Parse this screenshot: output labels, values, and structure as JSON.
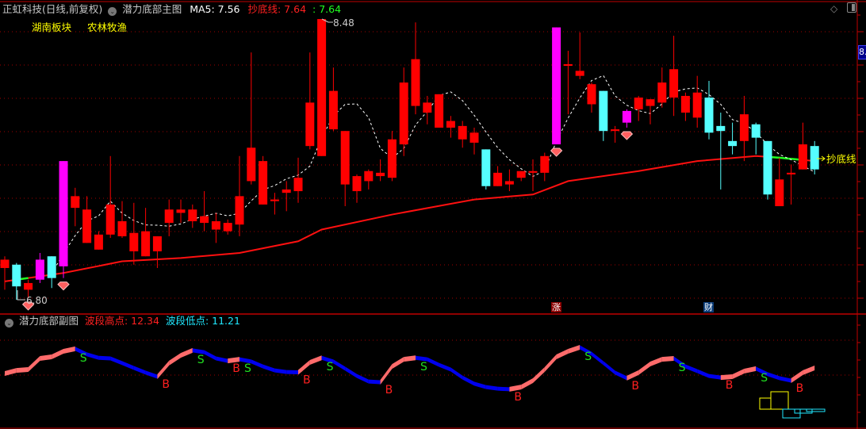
{
  "header": {
    "stock_title": "正虹科技(日线,前复权)",
    "main_indicator": "潜力底部主图",
    "ma5_label": "MA5: 7.56",
    "chaodi_label": "抄底线: 7.64",
    "chaodi_value2": ": 7.64",
    "sectors": [
      "湖南板块",
      "农林牧渔"
    ]
  },
  "sub_header": {
    "indicator": "潜力底部副图",
    "high_label": "波段高点: 12.34",
    "low_label": "波段低点: 11.21"
  },
  "annotations": {
    "high_marker": "8.48",
    "low_marker": "6.80",
    "chaodi_line_label": "抄底线",
    "badge_zhang": "涨",
    "badge_cai": "财",
    "axis_value": "8."
  },
  "colors": {
    "up": "#ff0000",
    "down": "#55ffff",
    "limit": "#ff00ff",
    "ma_long": "#ff1010",
    "rise": "#ff6b6b",
    "fall": "#0000ee"
  },
  "chart_data": {
    "type": "candlestick",
    "candles": [
      [
        6.99,
        7.06,
        6.86,
        7.04
      ],
      [
        7.01,
        7.02,
        6.8,
        6.88
      ],
      [
        6.86,
        6.92,
        6.81,
        6.9
      ],
      [
        6.92,
        7.08,
        6.9,
        7.04,
        "limit"
      ],
      [
        7.06,
        7.06,
        6.87,
        6.93
      ],
      [
        7.0,
        7.63,
        6.93,
        7.63,
        "limit"
      ],
      [
        7.35,
        7.47,
        7.24,
        7.42
      ],
      [
        7.14,
        7.42,
        7.14,
        7.34
      ],
      [
        7.1,
        7.21,
        7.1,
        7.19
      ],
      [
        7.19,
        7.66,
        7.17,
        7.37
      ],
      [
        7.18,
        7.39,
        7.17,
        7.27
      ],
      [
        7.09,
        7.38,
        7.01,
        7.2
      ],
      [
        7.06,
        7.35,
        7.06,
        7.21
      ],
      [
        7.09,
        7.18,
        6.99,
        7.18
      ],
      [
        7.26,
        7.4,
        7.18,
        7.34
      ],
      [
        7.32,
        7.4,
        7.26,
        7.34
      ],
      [
        7.27,
        7.37,
        7.23,
        7.34
      ],
      [
        7.26,
        7.45,
        7.21,
        7.3
      ],
      [
        7.22,
        7.32,
        7.14,
        7.27
      ],
      [
        7.21,
        7.28,
        7.19,
        7.26
      ],
      [
        7.25,
        7.66,
        7.18,
        7.42
      ],
      [
        7.51,
        8.28,
        7.49,
        7.71
      ],
      [
        7.37,
        7.66,
        7.37,
        7.63
      ],
      [
        7.39,
        7.44,
        7.31,
        7.4
      ],
      [
        7.44,
        7.51,
        7.33,
        7.46
      ],
      [
        7.45,
        7.65,
        7.38,
        7.53
      ],
      [
        7.72,
        8.28,
        7.7,
        7.98
      ],
      [
        7.66,
        8.48,
        7.66,
        8.48
      ],
      [
        7.82,
        8.19,
        7.81,
        8.05
      ],
      [
        7.49,
        7.81,
        7.36,
        7.81
      ],
      [
        7.45,
        7.55,
        7.38,
        7.54
      ],
      [
        7.51,
        7.58,
        7.46,
        7.57
      ],
      [
        7.54,
        7.64,
        7.51,
        7.56
      ],
      [
        7.53,
        7.81,
        7.51,
        7.76
      ],
      [
        7.73,
        8.19,
        7.66,
        8.1
      ],
      [
        7.96,
        8.46,
        7.91,
        8.24
      ],
      [
        7.92,
        8.02,
        7.85,
        7.98
      ],
      [
        7.83,
        8.03,
        7.83,
        8.03
      ],
      [
        7.83,
        7.9,
        7.77,
        7.87
      ],
      [
        7.76,
        7.87,
        7.71,
        7.84
      ],
      [
        7.74,
        7.83,
        7.67,
        7.8
      ],
      [
        7.7,
        7.7,
        7.46,
        7.48
      ],
      [
        7.48,
        7.6,
        7.48,
        7.56
      ],
      [
        7.49,
        7.58,
        7.45,
        7.51
      ],
      [
        7.53,
        7.57,
        7.51,
        7.57
      ],
      [
        7.56,
        7.64,
        7.45,
        7.57
      ],
      [
        7.56,
        7.68,
        7.51,
        7.66
      ],
      [
        7.73,
        8.43,
        7.73,
        8.43,
        "limit"
      ],
      [
        8.2,
        8.29,
        7.91,
        8.21
      ],
      [
        8.14,
        8.4,
        8.12,
        8.17
      ],
      [
        7.97,
        8.1,
        7.92,
        8.09
      ],
      [
        8.05,
        8.05,
        7.75,
        7.81
      ],
      [
        7.81,
        7.84,
        7.74,
        7.82
      ],
      [
        7.86,
        7.94,
        7.83,
        7.93,
        "limit"
      ],
      [
        7.94,
        8.02,
        7.87,
        8.01
      ],
      [
        7.96,
        8.0,
        7.85,
        8.0
      ],
      [
        7.98,
        8.19,
        7.95,
        8.1
      ],
      [
        8.01,
        8.38,
        7.9,
        8.18
      ],
      [
        7.92,
        8.04,
        7.87,
        8.02
      ],
      [
        7.89,
        8.14,
        7.83,
        8.04
      ],
      [
        8.01,
        8.11,
        7.76,
        7.8
      ],
      [
        7.84,
        7.92,
        7.46,
        7.81
      ],
      [
        7.75,
        7.86,
        7.67,
        7.72
      ],
      [
        7.75,
        8.02,
        7.63,
        7.91
      ],
      [
        7.85,
        7.86,
        7.67,
        7.77
      ],
      [
        7.75,
        7.75,
        7.4,
        7.43
      ],
      [
        7.36,
        7.65,
        7.36,
        7.52
      ],
      [
        7.55,
        7.61,
        7.37,
        7.56
      ],
      [
        7.58,
        7.86,
        7.58,
        7.73
      ],
      [
        7.72,
        7.75,
        7.55,
        7.58
      ]
    ],
    "price_range": [
      6.8,
      8.48
    ],
    "ma_long": [
      [
        0,
        6.91
      ],
      [
        5,
        6.96
      ],
      [
        10,
        7.03
      ],
      [
        15,
        7.05
      ],
      [
        20,
        7.08
      ],
      [
        25,
        7.15
      ],
      [
        27,
        7.22
      ],
      [
        33,
        7.31
      ],
      [
        40,
        7.4
      ],
      [
        45,
        7.43
      ],
      [
        48,
        7.51
      ],
      [
        54,
        7.57
      ],
      [
        59,
        7.63
      ],
      [
        64,
        7.66
      ],
      [
        66,
        7.65
      ],
      [
        69,
        7.63
      ]
    ],
    "ma_long_green_ranges": [
      [
        1,
        2
      ],
      [
        65,
        68
      ]
    ],
    "signal_diamonds": [
      2,
      5,
      47,
      53
    ],
    "wave": [
      11.26,
      11.36,
      11.39,
      11.75,
      11.8,
      11.98,
      12.06,
      11.88,
      11.77,
      11.75,
      11.6,
      11.44,
      11.29,
      11.16,
      11.6,
      11.85,
      12.01,
      11.95,
      11.75,
      11.67,
      11.72,
      11.65,
      11.49,
      11.36,
      11.31,
      11.3,
      11.62,
      11.77,
      11.65,
      11.42,
      11.18,
      11.0,
      10.98,
      11.49,
      11.72,
      11.77,
      11.72,
      11.54,
      11.39,
      11.13,
      10.93,
      10.82,
      10.77,
      10.75,
      10.82,
      11.03,
      11.39,
      11.8,
      11.98,
      12.11,
      11.9,
      11.6,
      11.29,
      11.11,
      11.29,
      11.57,
      11.72,
      11.75,
      11.49,
      11.34,
      11.18,
      11.13,
      11.16,
      11.34,
      11.42,
      11.24,
      11.11,
      11.03,
      11.29,
      11.44
    ],
    "wave_labels": {
      "sell": "S",
      "buy": "B"
    }
  }
}
